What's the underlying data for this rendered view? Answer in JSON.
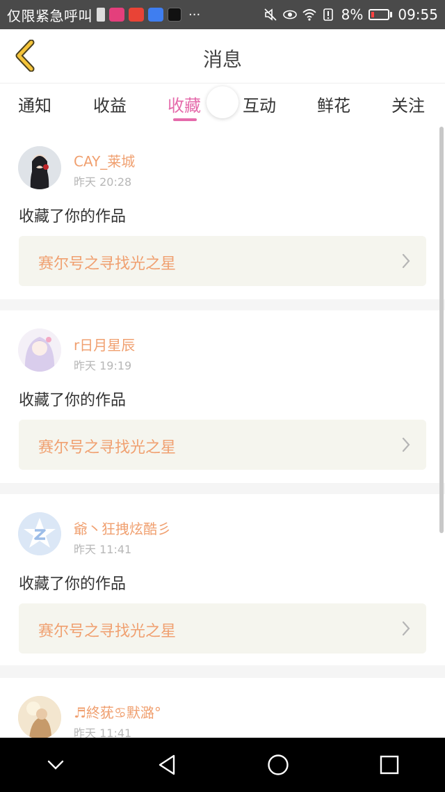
{
  "status_bar": {
    "carrier_text": "仅限紧急呼叫",
    "more": "···",
    "battery": "8%",
    "time": "09:55",
    "icons": [
      "sim-icon",
      "video-app-icon",
      "news-app-icon",
      "media-app-icon",
      "tiktok-icon",
      "mute-icon",
      "eye-icon",
      "wifi-icon",
      "alert-icon",
      "battery-icon"
    ]
  },
  "header": {
    "title": "消息",
    "back_icon": "chevron-left-icon"
  },
  "tabs": [
    {
      "label": "通知"
    },
    {
      "label": "收益"
    },
    {
      "label": "收藏",
      "active": true
    },
    {
      "label": "互动"
    },
    {
      "label": "鲜花"
    },
    {
      "label": "关注"
    }
  ],
  "notifications": [
    {
      "username": "CAY_莱城",
      "time": "昨天 20:28",
      "action": "收藏了你的作品",
      "work_title": "赛尔号之寻找光之星"
    },
    {
      "username": "r日月星辰",
      "time": "昨天 19:19",
      "action": "收藏了你的作品",
      "work_title": "赛尔号之寻找光之星"
    },
    {
      "username": "爺丶狂拽炫酷彡",
      "time": "昨天 11:41",
      "action": "收藏了你的作品",
      "work_title": "赛尔号之寻找光之星"
    },
    {
      "username": "♬終莸♋默潞°",
      "time": "昨天 11:41"
    }
  ],
  "colors": {
    "accent_pink": "#e56bab",
    "username_orange": "#f0a070",
    "card_bg": "#f5f5ee"
  },
  "nav": {
    "icons": [
      "chevron-down-icon",
      "back-triangle-icon",
      "home-circle-icon",
      "recents-square-icon"
    ]
  }
}
